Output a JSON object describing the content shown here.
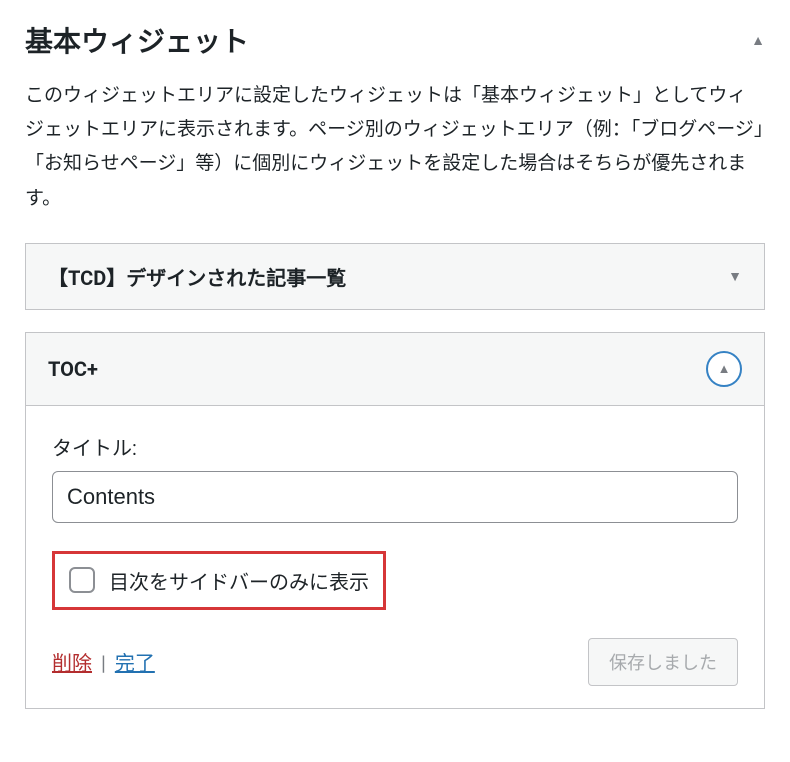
{
  "section": {
    "title": "基本ウィジェット",
    "description": "このウィジェットエリアに設定したウィジェットは「基本ウィジェット」としてウィジェットエリアに表示されます。ページ別のウィジェットエリア（例：「ブログページ」「お知らせページ」等）に個別にウィジェットを設定した場合はそちらが優先されます。"
  },
  "widgets": {
    "collapsed": {
      "title": "【TCD】デザインされた記事一覧"
    },
    "expanded": {
      "title": "TOC+",
      "title_field_label": "タイトル:",
      "title_field_value": "Contents",
      "checkbox_label": "目次をサイドバーのみに表示",
      "checkbox_checked": false,
      "delete_label": "削除",
      "done_label": "完了",
      "saved_label": "保存しました"
    }
  }
}
